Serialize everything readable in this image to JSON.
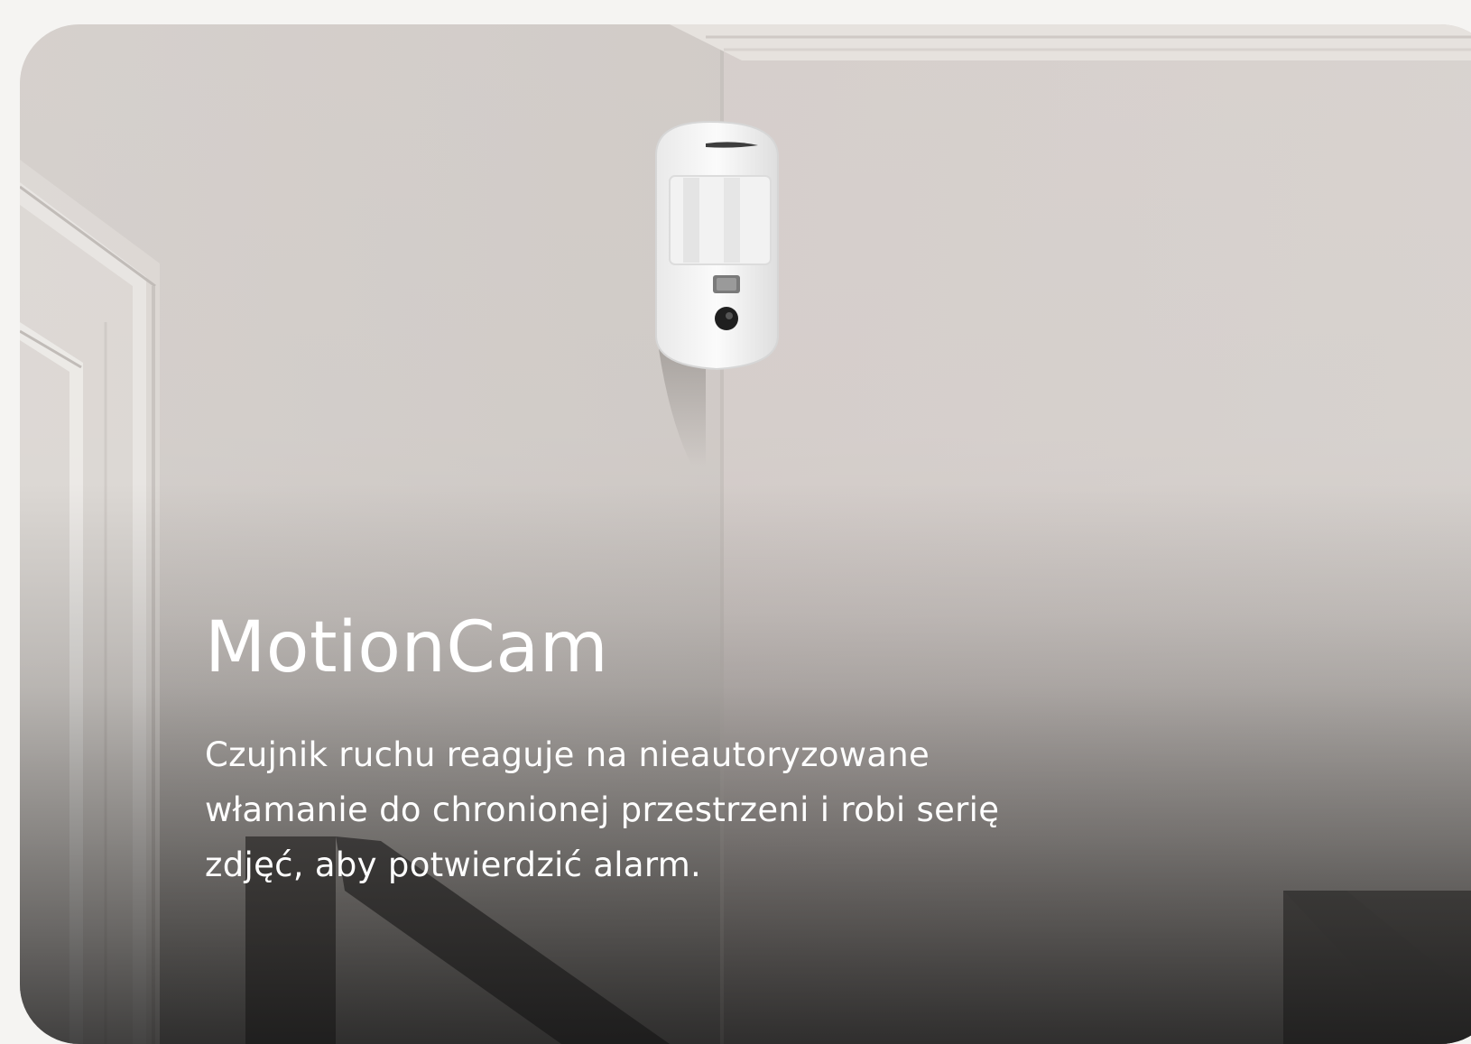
{
  "card": {
    "title": "MotionCam",
    "description": "Czujnik ruchu reaguje na nieautoryzowane włamanie do chronionej przestrzeni i robi serię zdjęć, aby potwierdzić alarm.",
    "image_subject": "motion-detector-camera-icon"
  },
  "colors": {
    "page_background": "#f5f4f2",
    "wall": "#d2ccc9",
    "text": "#ffffff"
  }
}
